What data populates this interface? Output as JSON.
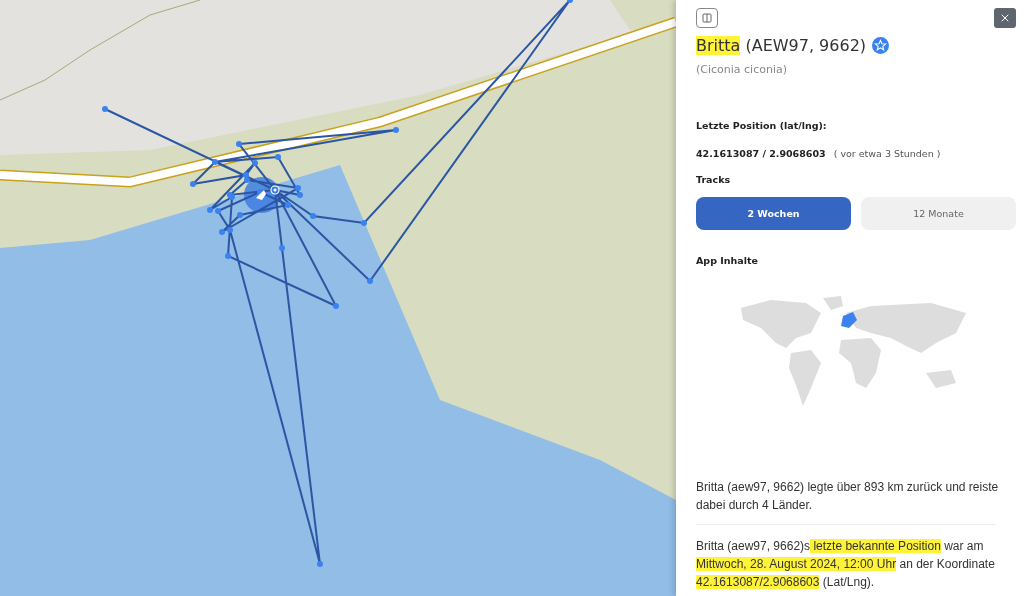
{
  "panel": {
    "title": {
      "name": "Britta",
      "name_highlighted": true,
      "ids": "(AEW97, 9662)",
      "favorite": true
    },
    "subtitle": "(Ciconia ciconia)",
    "last_position_label": "Letzte Position (lat/lng):",
    "coordinates": "42.1613087 / 2.9068603",
    "time_ago": "( vor etwa 3 Stunden )",
    "tracks_label": "Tracks",
    "track_tabs": [
      {
        "label": "2 Wochen",
        "selected": true
      },
      {
        "label": "12 Monate",
        "selected": false
      }
    ],
    "app_content_label": "App Inhalte",
    "paragraphs": [
      {
        "segments": [
          {
            "text": "Britta (aew97, 9662) legte über 893 km zurück und reiste dabei durch 4 Länder.",
            "highlighted": false
          }
        ]
      },
      {
        "segments": [
          {
            "text": "Britta (aew97, 9662)s",
            "highlighted": false
          },
          {
            "text": " letzte bekannte Position",
            "highlighted": true
          },
          {
            "text": " war am ",
            "highlighted": false
          },
          {
            "text": "Mittwoch, 28. August 2024, 12:00 Uhr",
            "highlighted": true
          },
          {
            "text": " an der Koordinate ",
            "highlighted": false
          },
          {
            "text": "42.1613087/2.9068603",
            "highlighted": true
          },
          {
            "text": " (Lat/Lng).",
            "highlighted": false
          }
        ]
      }
    ]
  }
}
